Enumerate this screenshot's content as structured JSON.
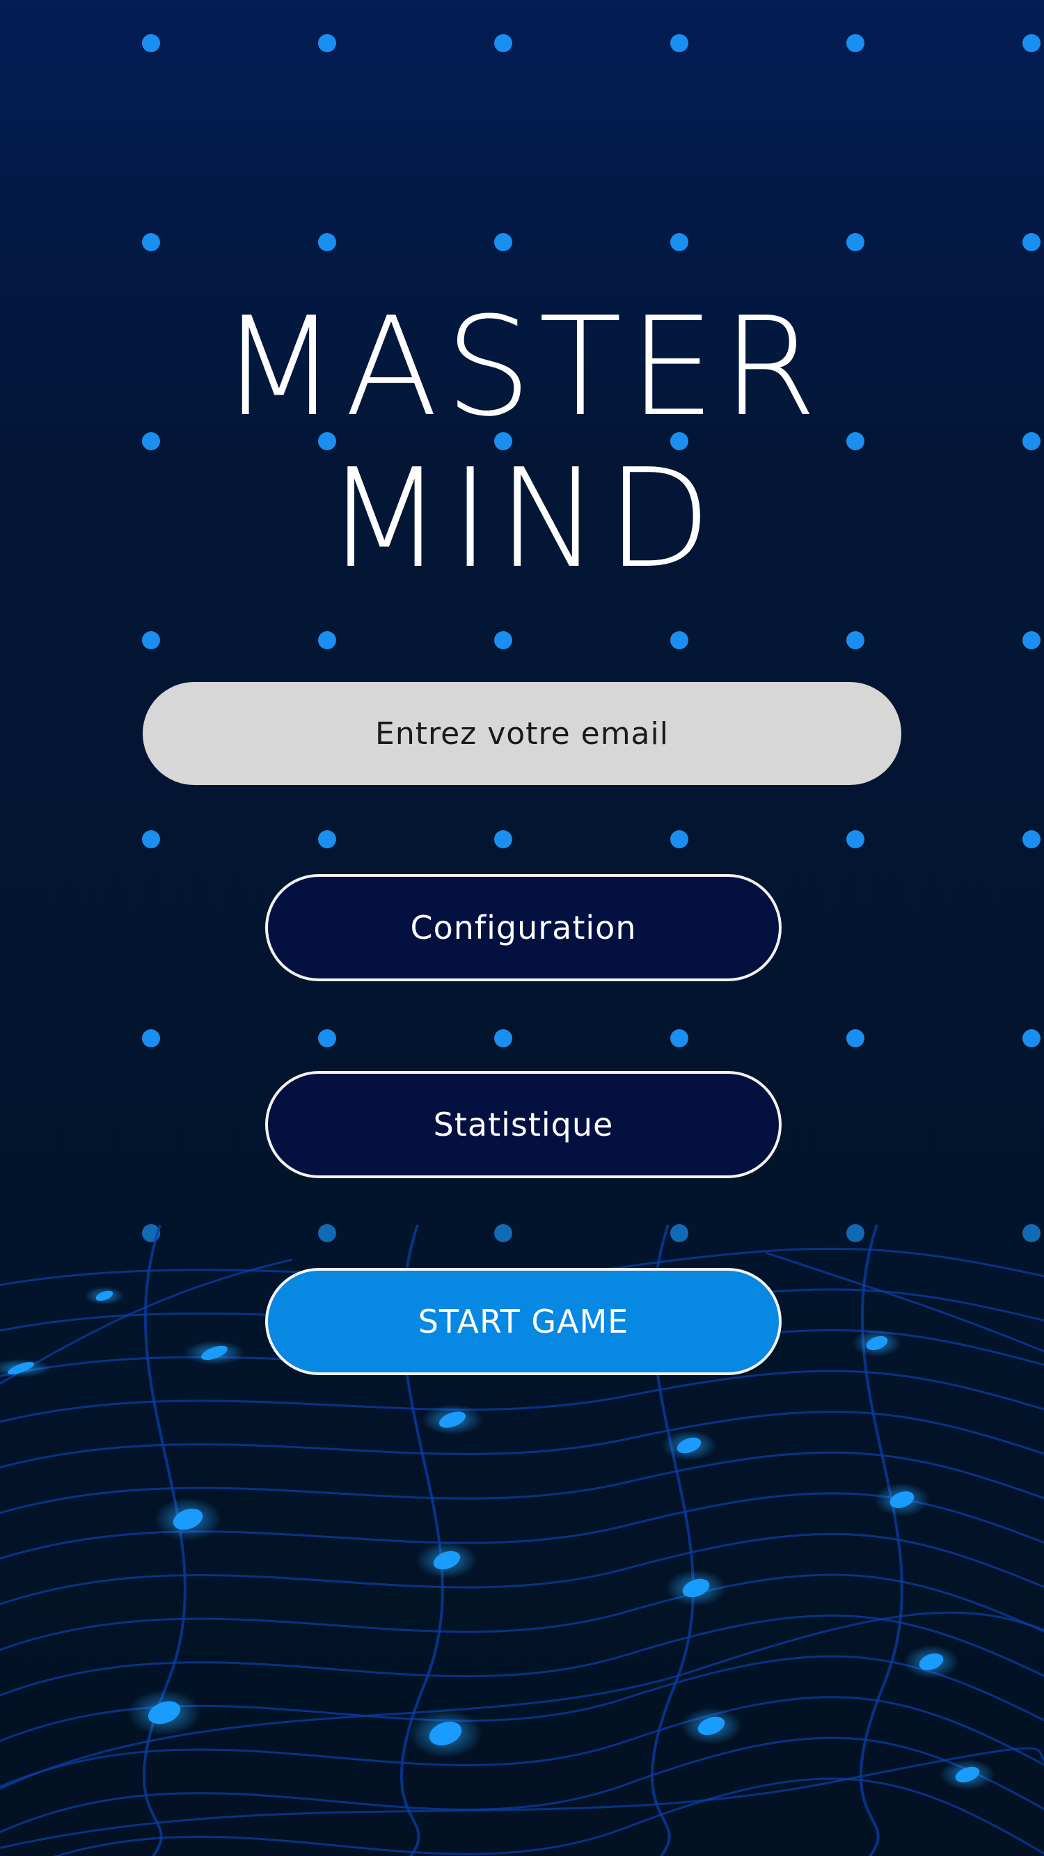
{
  "title": {
    "line1": "MASTER",
    "line2": "MIND"
  },
  "email": {
    "placeholder": "Entrez votre email",
    "value": ""
  },
  "buttons": {
    "configuration": "Configuration",
    "statistics": "Statistique",
    "start": "START GAME"
  },
  "colors": {
    "background": "#021226",
    "grid_line": "#0a4fd1",
    "grid_dot": "#1a8ff0",
    "input_bg": "#d7d7d7",
    "button_bg": "#031040",
    "start_button_bg": "#0788e3",
    "button_border": "#f3f3f3",
    "title": "#ffffff"
  }
}
